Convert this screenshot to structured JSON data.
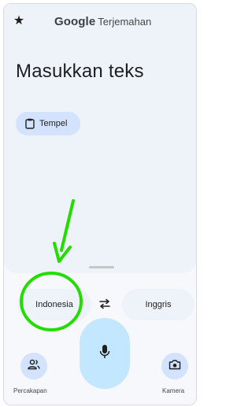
{
  "header": {
    "brand": "Google",
    "product": "Terjemahan",
    "favorite_icon": "star-icon"
  },
  "input": {
    "placeholder": "Masukkan teks"
  },
  "paste_chip": {
    "label": "Tempel",
    "icon": "clipboard-icon"
  },
  "language_bar": {
    "source": "Indonesia",
    "target": "Inggris",
    "swap_icon": "swap-arrows-icon"
  },
  "bottom_bar": {
    "conversation_label": "Percakapan",
    "conversation_icon": "people-icon",
    "mic_icon": "microphone-icon",
    "camera_label": "Kamera",
    "camera_icon": "camera-icon"
  },
  "annotation": {
    "color": "#22dd00",
    "highlight_target": "Indonesia"
  },
  "colors": {
    "top_area_bg": "#eef2f9",
    "chip_bg": "#d3e3fd",
    "mic_bg": "#c2e7ff"
  }
}
